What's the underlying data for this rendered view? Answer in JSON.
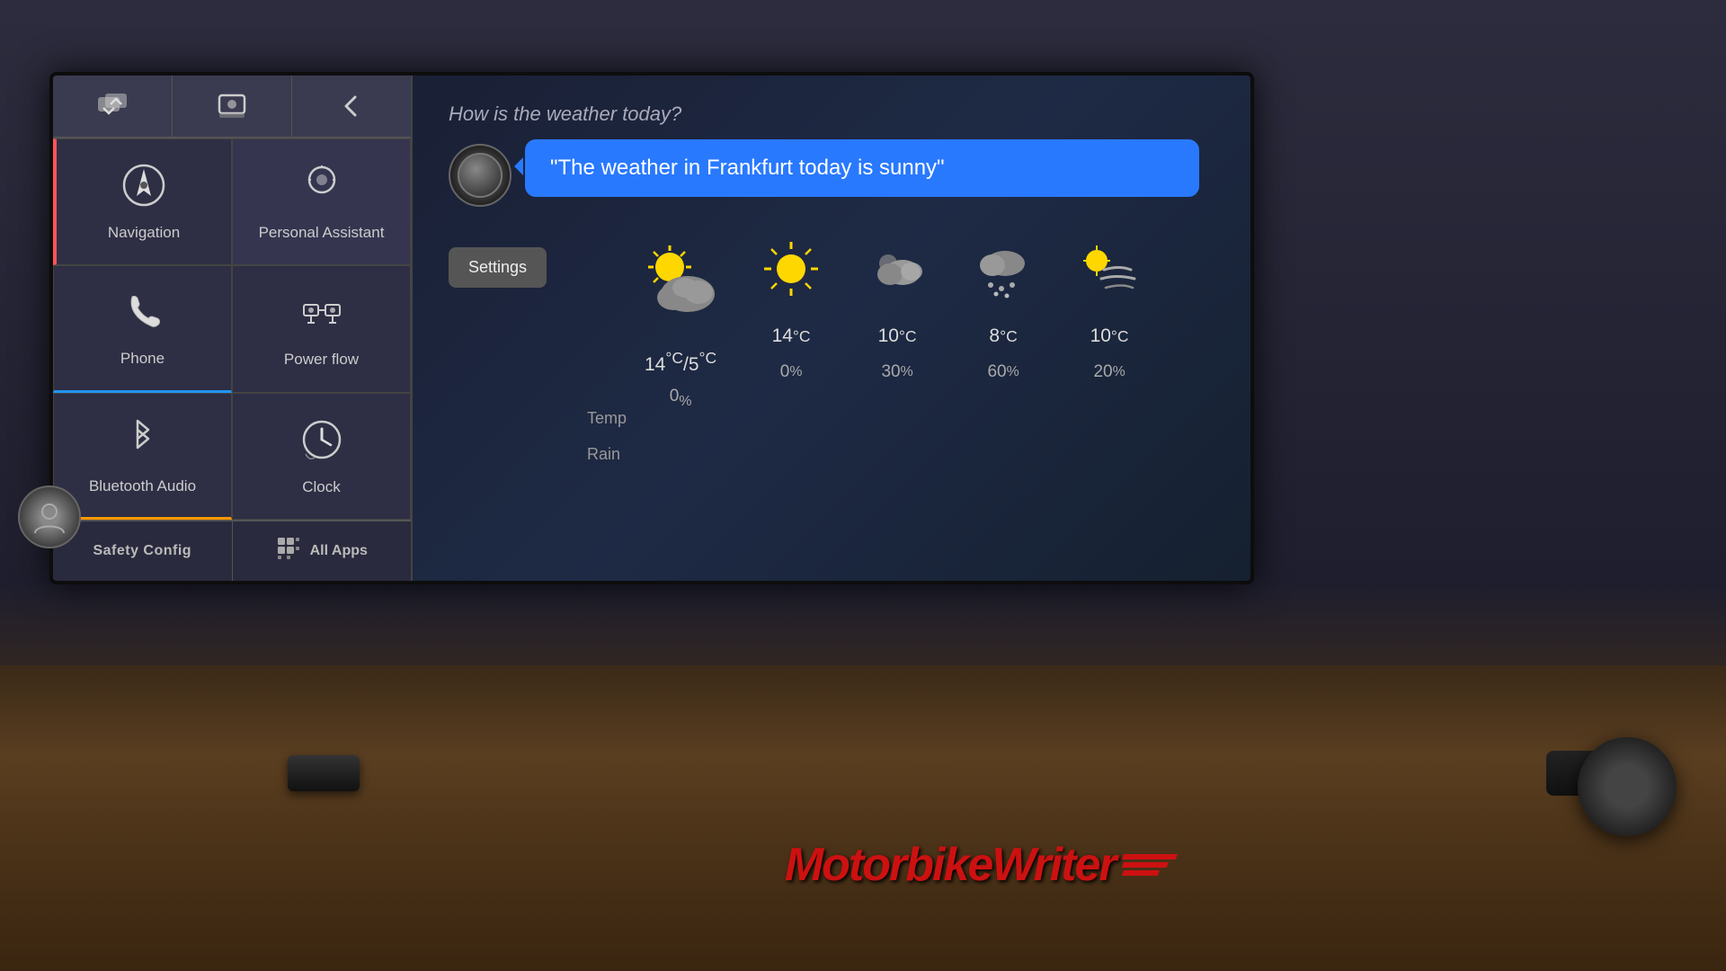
{
  "toolbar": {
    "btn1_icon": "⇄",
    "btn2_icon": "⊟",
    "btn3_icon": "↩"
  },
  "apps": [
    {
      "id": "navigation",
      "label": "Navigation",
      "icon": "nav",
      "active": "nav"
    },
    {
      "id": "personal-assistant",
      "label": "Personal Assistant",
      "icon": "pa",
      "active": "none"
    },
    {
      "id": "phone",
      "label": "Phone",
      "icon": "phone",
      "active": "phone"
    },
    {
      "id": "power-flow",
      "label": "Power flow",
      "icon": "powerflow",
      "active": "none"
    },
    {
      "id": "bluetooth-audio",
      "label": "Bluetooth Audio",
      "icon": "bluetooth",
      "active": "bt"
    },
    {
      "id": "clock",
      "label": "Clock",
      "icon": "clock",
      "active": "none"
    }
  ],
  "bottom_bar": {
    "safety_label": "Safety Config",
    "all_apps_label": "All Apps"
  },
  "weather": {
    "question": "How is the weather today?",
    "speech_text": "\"The weather in Frankfurt today is sunny\"",
    "settings_label": "Settings",
    "columns": [
      {
        "icon": "partly-cloudy",
        "temp": "14°C/5°C",
        "temp_raw": "14",
        "temp_low": "5",
        "rain": "0%",
        "rain_raw": "0",
        "is_main": true
      },
      {
        "icon": "sunny",
        "temp": "14°C",
        "temp_raw": "14",
        "rain": "0%",
        "rain_raw": "0",
        "is_main": false
      },
      {
        "icon": "cloudy",
        "temp": "10°C",
        "temp_raw": "10",
        "rain": "30%",
        "rain_raw": "30",
        "is_main": false
      },
      {
        "icon": "rainy",
        "temp": "8°C",
        "temp_raw": "8",
        "rain": "60%",
        "rain_raw": "60",
        "is_main": false
      },
      {
        "icon": "windy-sunny",
        "temp": "10°C",
        "temp_raw": "10",
        "rain": "20%",
        "rain_raw": "20",
        "is_main": false
      }
    ],
    "row_labels": {
      "temp": "Temp",
      "rain": "Rain"
    }
  },
  "watermark": {
    "text": "MotorbikeWriter"
  }
}
